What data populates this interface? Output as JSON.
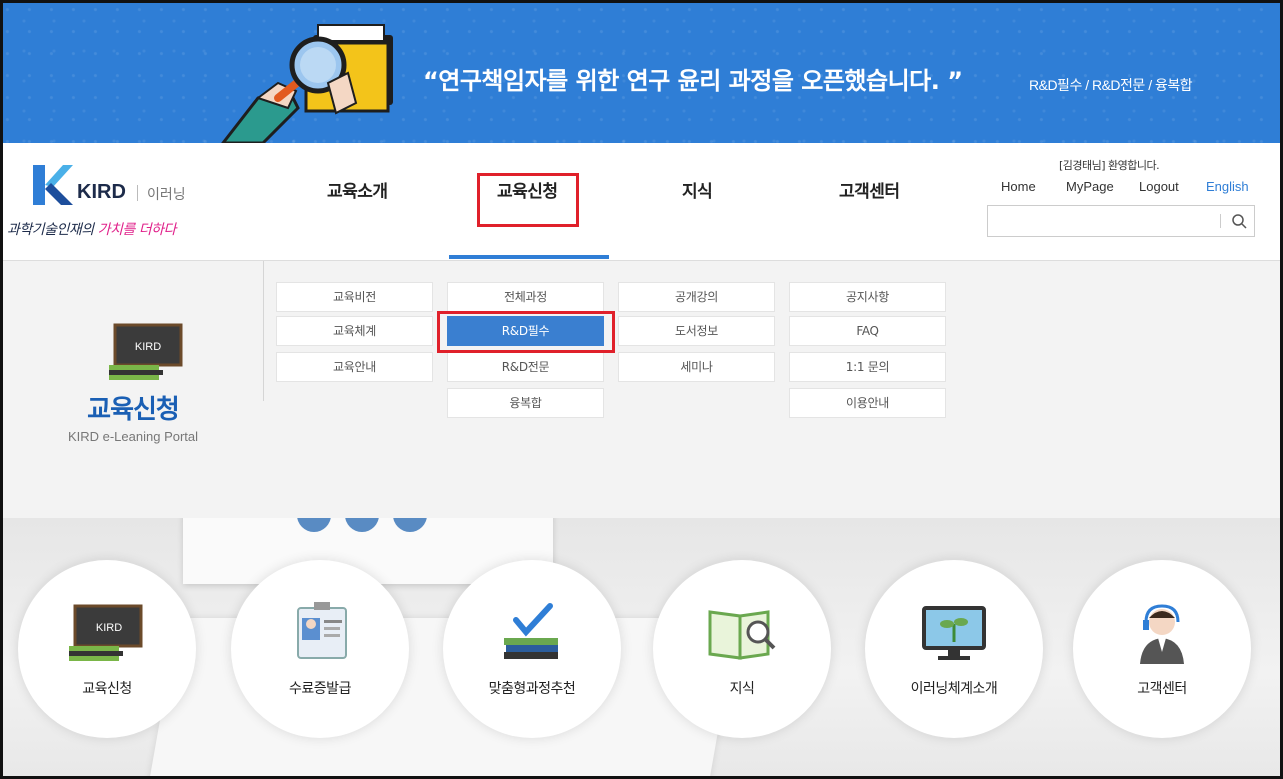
{
  "banner": {
    "headline": "“연구책임자를 위한 연구 윤리 과정을 오픈했습니다. ”",
    "subtext": "R&D필수 / R&D전문 / 융복합",
    "bg_color": "#2f7ed6"
  },
  "logo": {
    "brand": "KIRD",
    "service": "이러닝",
    "slogan_prefix": "과학기술인재의 ",
    "slogan_highlight": "가치를 더하다"
  },
  "gnb": {
    "items": [
      {
        "label": "교육소개"
      },
      {
        "label": "교육신청",
        "active": true
      },
      {
        "label": "지식"
      },
      {
        "label": "고객센터"
      }
    ]
  },
  "util": {
    "welcome": "[김경태님] 환영합니다.",
    "home": "Home",
    "mypage": "MyPage",
    "logout": "Logout",
    "english": "English"
  },
  "search": {
    "placeholder": "",
    "icon": "search-icon"
  },
  "mega": {
    "section_title": "교육신청",
    "section_sub": "KIRD e-Leaning Portal",
    "col1": [
      "교육비전",
      "교육체계",
      "교육안내"
    ],
    "col2": [
      "전체과정",
      "R&D필수",
      "R&D전문",
      "융복합"
    ],
    "col3": [
      "공개강의",
      "도서정보",
      "세미나"
    ],
    "col4": [
      "공지사항",
      "FAQ",
      "1:1 문의",
      "이용안내"
    ],
    "active_item": "R&D필수"
  },
  "quick_menu": [
    {
      "label": "교육신청",
      "icon": "kird-board-icon"
    },
    {
      "label": "수료증발급",
      "icon": "id-card-icon"
    },
    {
      "label": "맞춤형과정추천",
      "icon": "books-check-icon"
    },
    {
      "label": "지식",
      "icon": "book-magnifier-icon"
    },
    {
      "label": "이러닝체계소개",
      "icon": "monitor-plant-icon"
    },
    {
      "label": "고객센터",
      "icon": "headset-agent-icon"
    }
  ],
  "colors": {
    "accent": "#2f7ed6",
    "active_menu": "#3a7fd0",
    "highlight_box": "#e0202a",
    "slogan_pink": "#e0208a"
  }
}
